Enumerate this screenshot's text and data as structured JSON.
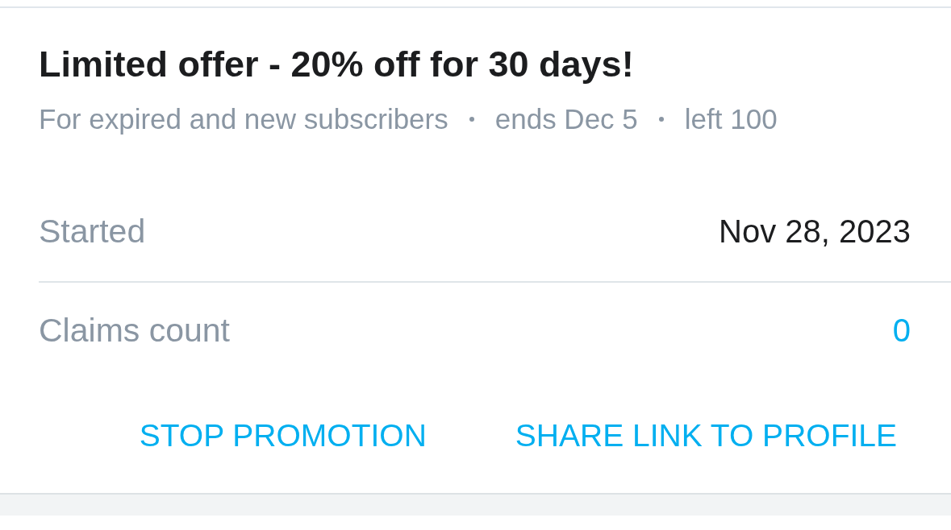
{
  "promotion": {
    "title": "Limited offer - 20% off for 30 days!",
    "details": [
      "For expired and new subscribers",
      "ends Dec 5",
      "left 100"
    ],
    "rows": [
      {
        "kind": "plain",
        "label": "Started",
        "value": "Nov 28, 2023"
      },
      {
        "kind": "link",
        "label": "Claims count",
        "value": "0"
      }
    ],
    "actions": [
      "STOP PROMOTION",
      "SHARE LINK TO PROFILE"
    ]
  }
}
